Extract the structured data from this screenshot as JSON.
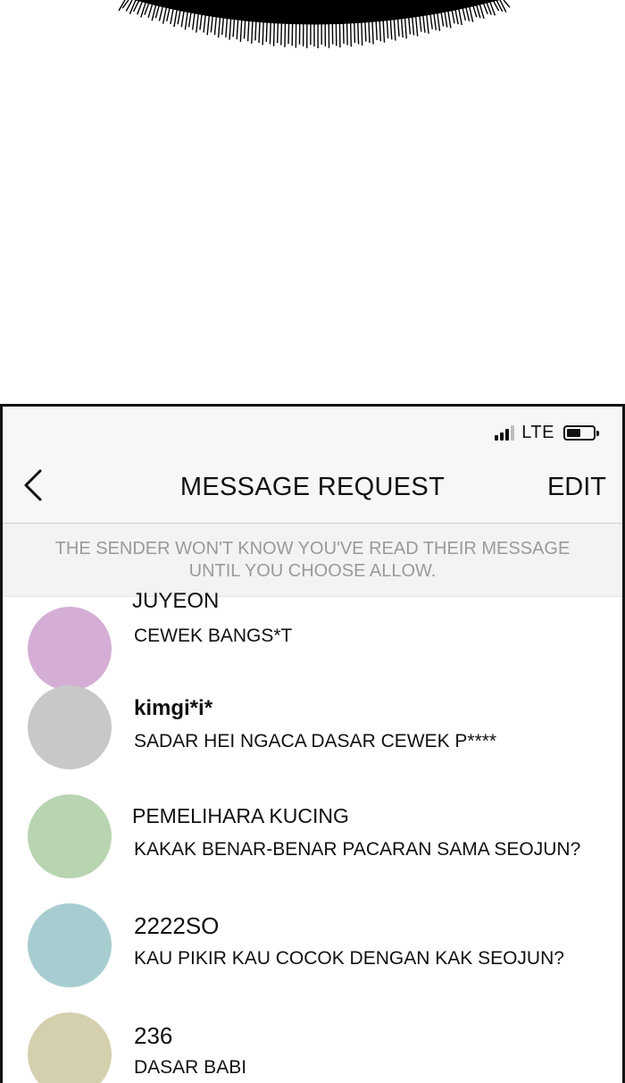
{
  "status_bar": {
    "network": "LTE",
    "signal_icon": "signal-bars-icon",
    "battery_icon": "battery-icon",
    "battery_level": 0.55
  },
  "header": {
    "back_icon": "chevron-left-icon",
    "title": "MESSAGE REQUEST",
    "edit_label": "EDIT"
  },
  "notice": {
    "line1": "THE SENDER WON'T KNOW YOU'VE READ THEIR MESSAGE",
    "line2": "UNTIL YOU CHOOSE ALLOW."
  },
  "requests": [
    {
      "name": "JUYEON",
      "message": "CEWEK BANGS*T",
      "avatar_color": "#d4aed4"
    },
    {
      "name": "kimgi*i*",
      "message": "SADAR HEI NGACA DASAR CEWEK P****",
      "avatar_color": "#c8c8c8"
    },
    {
      "name": "PEMELIHARA KUCING",
      "message": "KAKAK BENAR-BENAR PACARAN SAMA SEOJUN?",
      "avatar_color": "#b8d4b0"
    },
    {
      "name": "2222SO",
      "message": "KAU PIKIR KAU COCOK DENGAN KAK SEOJUN?",
      "avatar_color": "#a7cdd0"
    },
    {
      "name": "236",
      "message": "DASAR BABI",
      "avatar_color": "#d4cfad"
    }
  ]
}
